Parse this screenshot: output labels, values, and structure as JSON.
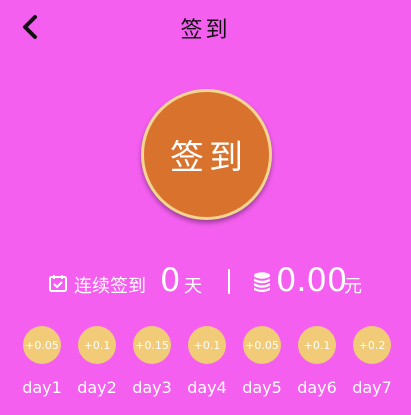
{
  "header": {
    "title": "签到",
    "back_icon": "chevron-left-icon"
  },
  "sign_button": {
    "label": "签到"
  },
  "stats": {
    "streak_label": "连续签到",
    "streak_days": "0",
    "streak_unit": "天",
    "calendar_icon": "calendar-check-icon",
    "coin_icon": "coins-stack-icon",
    "balance": "0.00",
    "balance_unit": "元"
  },
  "days": [
    {
      "reward": "+0.05",
      "label": "day1"
    },
    {
      "reward": "+0.1",
      "label": "day2"
    },
    {
      "reward": "+0.15",
      "label": "day3"
    },
    {
      "reward": "+0.1",
      "label": "day4"
    },
    {
      "reward": "+0.05",
      "label": "day5"
    },
    {
      "reward": "+0.1",
      "label": "day6"
    },
    {
      "reward": "+0.2",
      "label": "day7"
    }
  ],
  "colors": {
    "background": "#f45ff0",
    "button": "#d9722d",
    "button_border": "#f1d590",
    "coin": "#f1cb78"
  }
}
